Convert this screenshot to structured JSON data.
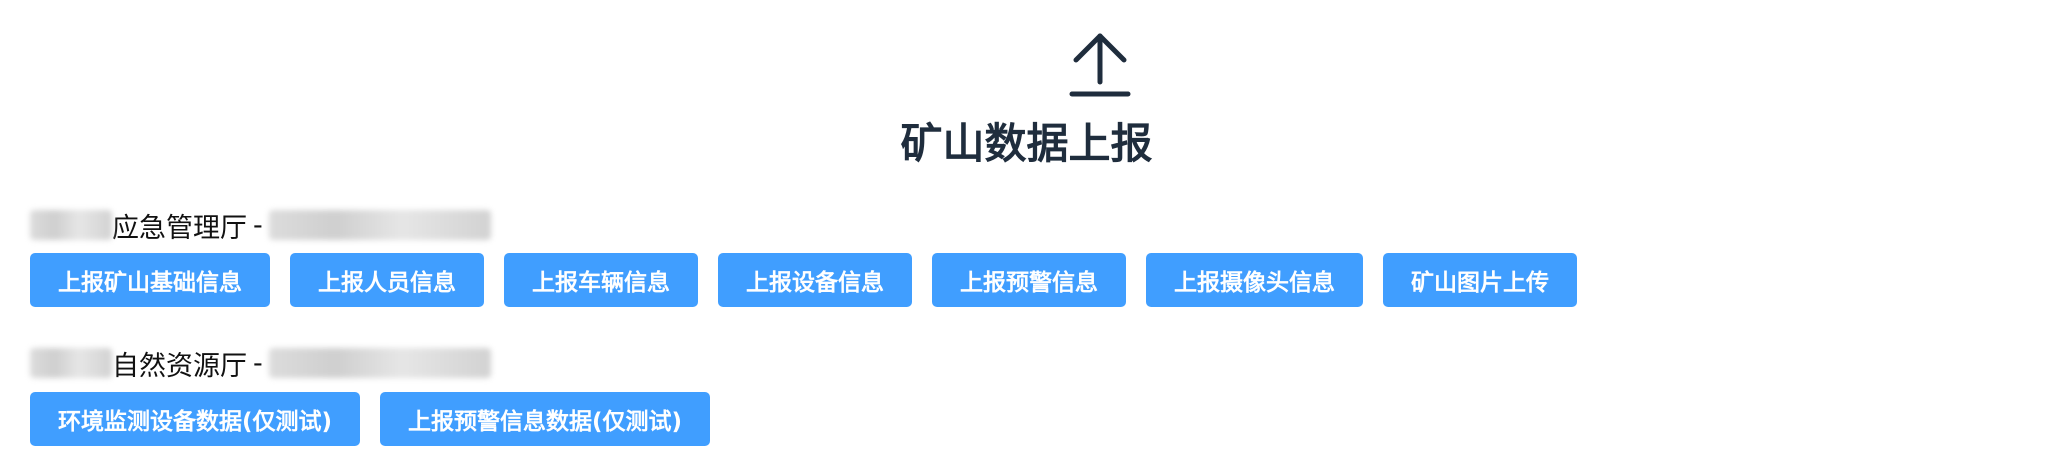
{
  "header": {
    "icon": "upload-arrow-icon",
    "title": "矿山数据上报"
  },
  "sections": [
    {
      "org_name": "应急管理厅",
      "separator": "-",
      "buttons": [
        {
          "label": "上报矿山基础信息"
        },
        {
          "label": "上报人员信息"
        },
        {
          "label": "上报车辆信息"
        },
        {
          "label": "上报设备信息"
        },
        {
          "label": "上报预警信息"
        },
        {
          "label": "上报摄像头信息"
        },
        {
          "label": "矿山图片上传"
        }
      ]
    },
    {
      "org_name": "自然资源厅",
      "separator": "-",
      "buttons": [
        {
          "label": "环境监测设备数据(仅测试)"
        },
        {
          "label": "上报预警信息数据(仅测试)"
        }
      ]
    }
  ],
  "colors": {
    "button_bg": "#409eff",
    "title": "#1f2d3d"
  }
}
